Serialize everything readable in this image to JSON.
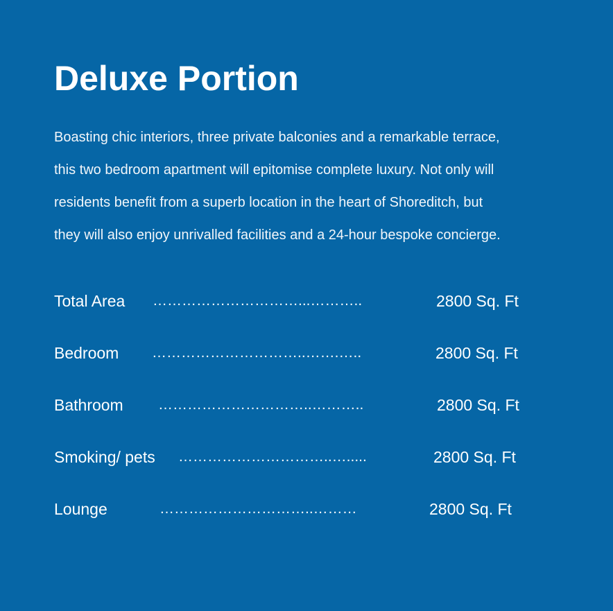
{
  "title": "Deluxe Portion",
  "description": [
    "Boasting chic interiors, three private balconies and a remarkable terrace,",
    "this two bedroom apartment will epitomise complete luxury. Not only will",
    "residents benefit from a superb location in the heart of Shoreditch, but",
    "they will also enjoy unrivalled facilities and a 24-hour bespoke concierge."
  ],
  "specs": [
    {
      "label": "Total Area",
      "dots": "…………………………...……….. ",
      "value": "2800 Sq. Ft"
    },
    {
      "label": "Bedroom",
      "dots": "…………………………..…….….. ",
      "value": "2800 Sq. Ft"
    },
    {
      "label": "Bathroom",
      "dots": "…………………………..……….. ",
      "value": "2800 Sq. Ft"
    },
    {
      "label": "Smoking/ pets",
      "dots": "…………………………..…..... ",
      "value": "2800 Sq. Ft"
    },
    {
      "label": "Lounge",
      "dots": "…………………………..……… ",
      "value": "2800 Sq. Ft"
    }
  ],
  "colors": {
    "background": "#0666a6",
    "text": "#ffffff"
  }
}
